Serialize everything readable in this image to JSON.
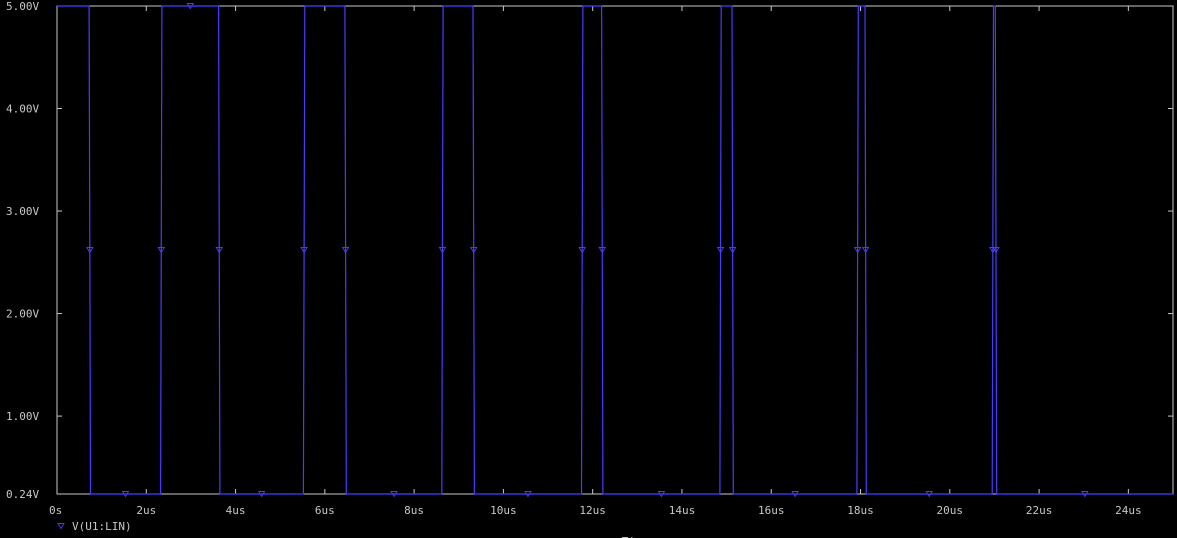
{
  "chart_data": {
    "type": "line",
    "title": "",
    "xlabel": "Time",
    "ylabel": "",
    "xlim": [
      0,
      25
    ],
    "ylim": [
      0.24,
      5.0
    ],
    "x_ticks": [
      0,
      2,
      4,
      6,
      8,
      10,
      12,
      14,
      16,
      18,
      20,
      22,
      24
    ],
    "x_tick_labels": [
      "0s",
      "2us",
      "4us",
      "6us",
      "8us",
      "10us",
      "12us",
      "14us",
      "16us",
      "18us",
      "20us",
      "22us",
      "24us"
    ],
    "y_ticks": [
      0.24,
      1.0,
      2.0,
      3.0,
      4.0,
      5.0
    ],
    "y_tick_labels": [
      "0.24V",
      "1.00V",
      "2.00V",
      "3.00V",
      "4.00V",
      "5.00V"
    ],
    "grid": false,
    "legend_position": "bottom-left",
    "colors": {
      "background": "#000000",
      "axes": "#c8c8c8",
      "trace": "#4a3cff"
    },
    "series": [
      {
        "name": "V(U1:LIN)",
        "marker": "triangle-down",
        "x": [
          0,
          0.72,
          0.75,
          2.32,
          2.35,
          3.62,
          3.65,
          5.52,
          5.55,
          6.45,
          6.48,
          8.62,
          8.65,
          9.32,
          9.35,
          11.75,
          11.78,
          12.2,
          12.23,
          14.85,
          14.88,
          15.12,
          15.15,
          17.92,
          17.95,
          18.1,
          18.13,
          20.95,
          20.98,
          21.02,
          21.05,
          25
        ],
        "y": [
          5.0,
          5.0,
          0.24,
          0.24,
          5.0,
          5.0,
          0.24,
          0.24,
          5.0,
          5.0,
          0.24,
          0.24,
          5.0,
          5.0,
          0.24,
          0.24,
          5.0,
          5.0,
          0.24,
          0.24,
          5.0,
          5.0,
          0.24,
          0.24,
          5.0,
          5.0,
          0.24,
          0.24,
          5.0,
          5.0,
          0.24,
          0.24
        ]
      }
    ]
  }
}
